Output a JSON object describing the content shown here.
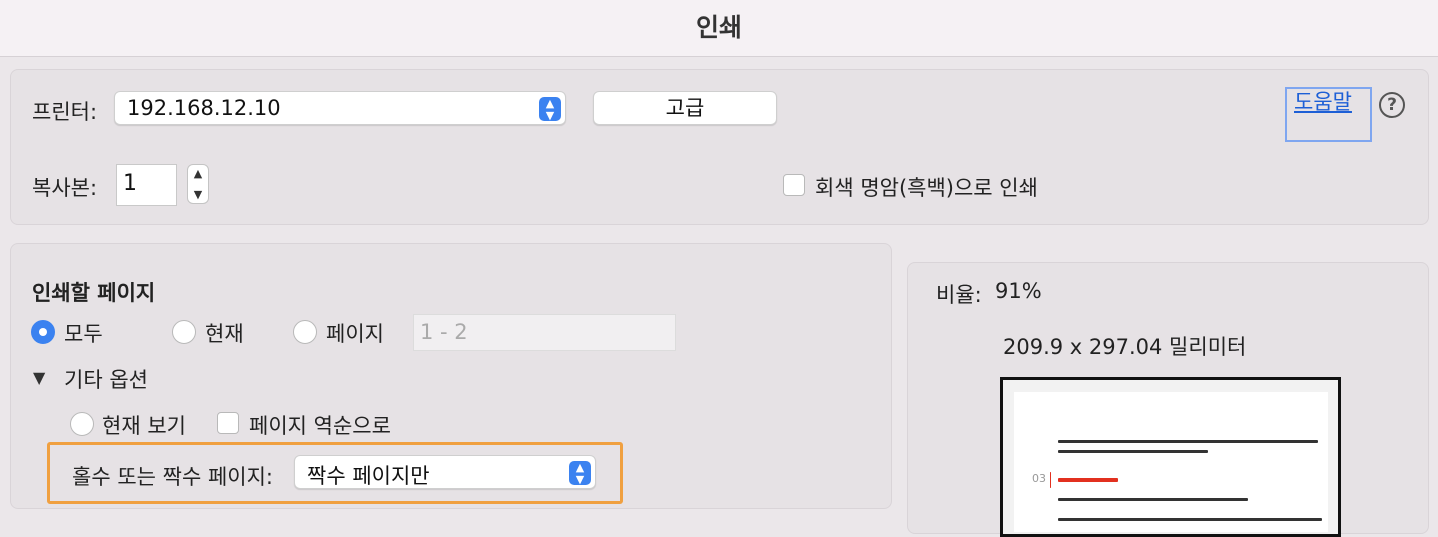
{
  "window": {
    "title": "인쇄"
  },
  "printer": {
    "label": "프린터:",
    "selected": "192.168.12.10",
    "advanced_button": "고급",
    "help_link": "도움말",
    "help_icon": "question-mark-icon"
  },
  "copies": {
    "label": "복사본:",
    "value": "1",
    "grayscale_label": "회색 명암(흑백)으로 인쇄",
    "grayscale_checked": false
  },
  "pages": {
    "heading": "인쇄할 페이지",
    "options": [
      {
        "label": "모두",
        "selected": true
      },
      {
        "label": "현재",
        "selected": false
      },
      {
        "label": "페이지",
        "selected": false
      }
    ],
    "range_placeholder": "1 - 2"
  },
  "more_options": {
    "toggle_label": "기타 옵션",
    "expanded": true,
    "current_view_label": "현재 보기",
    "reverse_order_label": "페이지 역순으로",
    "odd_even_label": "홀수 또는 짝수 페이지:",
    "odd_even_selected": "짝수 페이지만"
  },
  "preview": {
    "scale_label": "비율:",
    "scale_value": "91%",
    "paper_size": "209.9 x 297.04 밀리미터",
    "page_number": "03"
  },
  "colors": {
    "accent": "#3b82f0",
    "highlight": "#f0a040",
    "link": "#1d5fd6"
  }
}
